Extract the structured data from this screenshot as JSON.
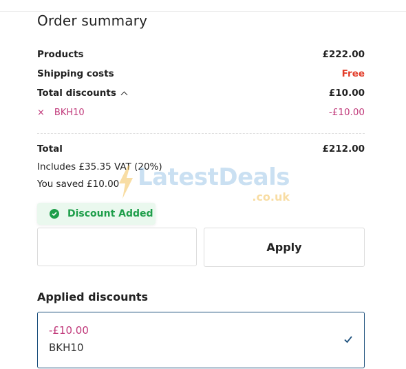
{
  "summary": {
    "title": "Order summary",
    "products_label": "Products",
    "products_value": "£222.00",
    "shipping_label": "Shipping costs",
    "shipping_value": "Free",
    "total_discounts_label": "Total discounts",
    "total_discounts_value": "£10.00",
    "discount_remove_glyph": "×",
    "discount_code": "BKH10",
    "discount_value": "-£10.00",
    "total_label": "Total",
    "total_value": "£212.00",
    "vat_text": "Includes £35.35 VAT (20%)",
    "saved_text": "You saved £10.00"
  },
  "watermark": {
    "text": "LatestDeals",
    "sub": ".co.uk"
  },
  "toast": {
    "text": "Discount Added",
    "icon": "check-circle-icon"
  },
  "discount_form": {
    "input_value": "",
    "input_placeholder": "",
    "apply_label": "Apply"
  },
  "applied": {
    "heading": "Applied discounts",
    "amount": "-£10.00",
    "code": "BKH10",
    "icon": "checkmark-icon"
  },
  "colors": {
    "accent_pink": "#c0397a",
    "free_red": "#e23c29",
    "success_green": "#1e9e4a",
    "card_border": "#1b4f7c"
  }
}
